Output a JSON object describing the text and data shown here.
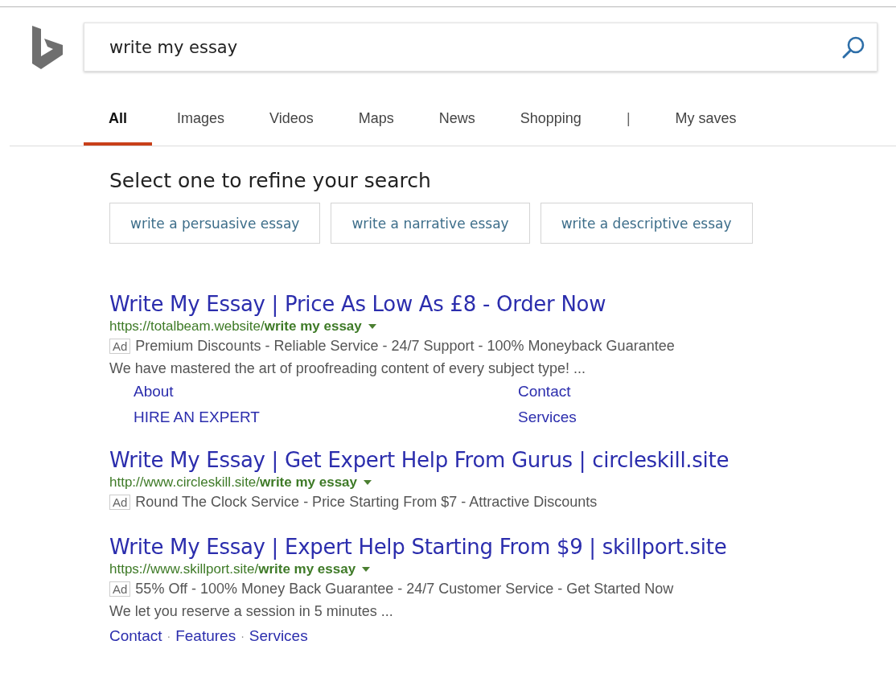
{
  "search": {
    "value": "write my essay"
  },
  "tabs": [
    {
      "label": "All",
      "selected": true
    },
    {
      "label": "Images",
      "selected": false
    },
    {
      "label": "Videos",
      "selected": false
    },
    {
      "label": "Maps",
      "selected": false
    },
    {
      "label": "News",
      "selected": false
    },
    {
      "label": "Shopping",
      "selected": false
    },
    {
      "label": "|",
      "kind": "divider"
    },
    {
      "label": "My saves",
      "selected": false
    }
  ],
  "refine": {
    "heading": "Select one to refine your search",
    "suggestions": [
      "write a persuasive essay",
      "write a narrative essay",
      "write a descriptive essay"
    ]
  },
  "results": [
    {
      "title": "Write My Essay | Price As Low As £8 - Order Now",
      "url": "https://totalbeam.website/**write my essay**",
      "ad_label": "Ad",
      "ad_text": "Premium Discounts - Reliable Service - 24/7 Support - 100% Moneyback Guarantee",
      "snippet": "We have mastered the art of proofreading content of every subject type! ...",
      "sitelinks": {
        "kind": "grid",
        "links": [
          "About",
          "Contact",
          "HIRE AN EXPERT",
          "Services"
        ]
      }
    },
    {
      "title": "Write My Essay | Get Expert Help From Gurus | circleskill.site",
      "url": "http://www.circleskill.site/**write my essay**",
      "ad_label": "Ad",
      "ad_text": "Round The Clock Service - Price Starting From $7 - Attractive Discounts"
    },
    {
      "title": "Write My Essay | Expert Help Starting From $9 | skillport.site",
      "url": "https://www.skillport.site/**write my essay**",
      "ad_label": "Ad",
      "ad_text": "55% Off - 100% Money Back Guarantee - 24/7 Customer Service - Get Started Now",
      "snippet": "We let you reserve a session in 5 minutes ...",
      "sitelinks": {
        "kind": "inline",
        "separator": "·",
        "links": [
          "Contact",
          "Features",
          "Services"
        ]
      }
    }
  ]
}
